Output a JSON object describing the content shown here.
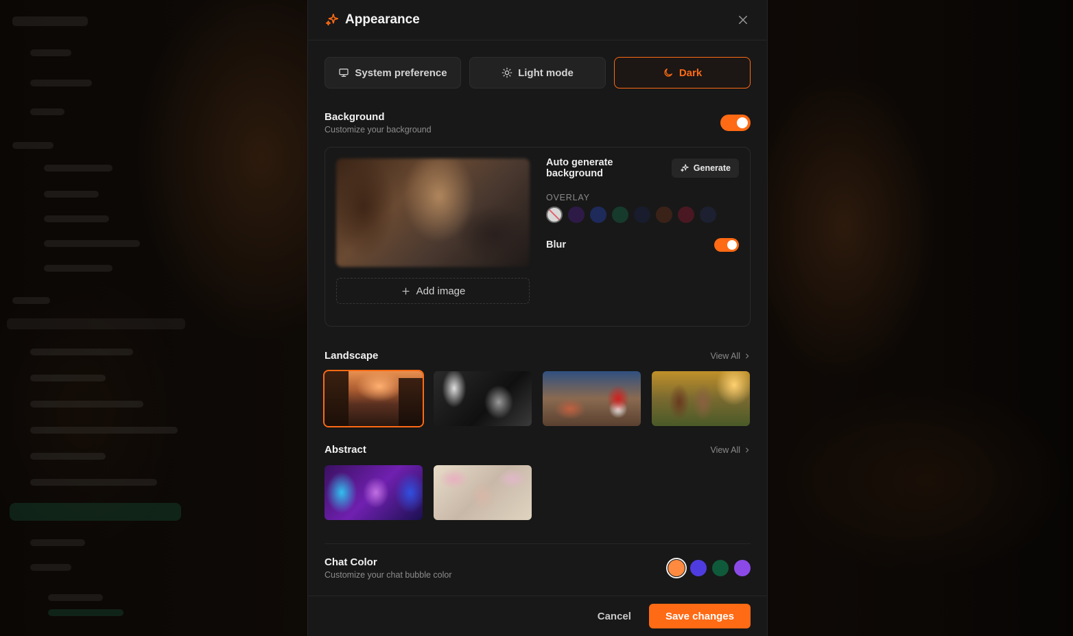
{
  "modal": {
    "title": "Appearance",
    "icons": {
      "title": "sparkle-icon",
      "close": "close-icon"
    }
  },
  "modes": [
    {
      "label": "System preference",
      "icon": "monitor-icon",
      "active": false
    },
    {
      "label": "Light mode",
      "icon": "sun-icon",
      "active": false
    },
    {
      "label": "Dark",
      "icon": "moon-icon",
      "active": true
    }
  ],
  "background": {
    "title": "Background",
    "subtitle": "Customize your background",
    "enabled": true,
    "add_image_label": "Add image",
    "auto_label": "Auto generate background",
    "generate_label": "Generate",
    "overlay_label": "OVERLAY",
    "overlay_colors": [
      "none",
      "#2e1a47",
      "#1e2a5a",
      "#163a2c",
      "#181c2c",
      "#3a2218",
      "#4a1822",
      "#1c2030"
    ],
    "blur_label": "Blur",
    "blur_enabled": true
  },
  "landscape": {
    "title": "Landscape",
    "view_all": "View All",
    "selected_index": 0,
    "count": 4
  },
  "abstract": {
    "title": "Abstract",
    "view_all": "View All",
    "count": 2
  },
  "chat_color": {
    "title": "Chat Color",
    "subtitle": "Customize your chat bubble color",
    "colors": [
      "#ff8a40",
      "#4f3ce0",
      "#0f5a3a",
      "#8b4ae8"
    ],
    "selected_index": 0
  },
  "footer": {
    "cancel": "Cancel",
    "save": "Save changes"
  },
  "accent": "#ff6a14"
}
